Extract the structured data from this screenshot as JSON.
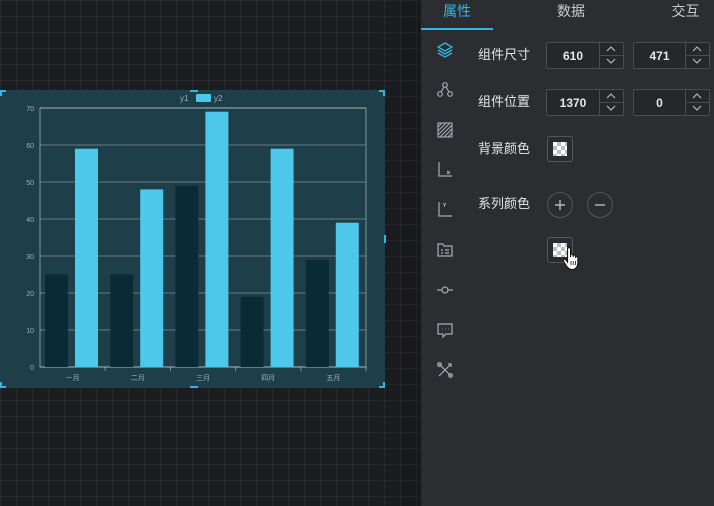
{
  "tabs": [
    {
      "label": "属性",
      "active": true
    },
    {
      "label": "数据",
      "active": false
    },
    {
      "label": "交互",
      "active": false
    }
  ],
  "props": {
    "size_label": "组件尺寸",
    "width": "610",
    "height": "471",
    "position_label": "组件位置",
    "pos_x": "1370",
    "pos_y": "0",
    "bg_color_label": "背景颜色",
    "series_color_label": "系列颜色"
  },
  "sidebar_icons": [
    "layers-icon",
    "nodes-icon",
    "texture-icon",
    "x-axis-icon",
    "y-axis-icon",
    "legend-icon",
    "series-icon",
    "tooltip-icon",
    "tools-icon"
  ],
  "colors": {
    "accent": "#2fb6e6",
    "series_y1": "#0a2b36",
    "series_y2": "#4ec8ea",
    "chart_bg": "#1e3e49"
  },
  "chart_data": {
    "type": "bar",
    "categories": [
      "一月",
      "二月",
      "三月",
      "四月",
      "五月"
    ],
    "series": [
      {
        "name": "y1",
        "values": [
          25,
          25,
          49,
          19,
          29
        ]
      },
      {
        "name": "y2",
        "values": [
          59,
          48,
          69,
          59,
          39
        ]
      }
    ],
    "y_ticks": [
      0,
      10,
      20,
      30,
      40,
      50,
      60,
      70
    ],
    "ylim": [
      0,
      70
    ],
    "grid": true,
    "legend": "top-center"
  }
}
